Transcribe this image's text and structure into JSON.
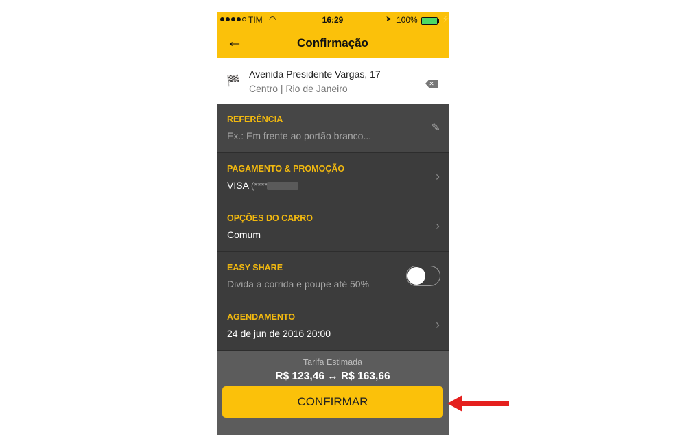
{
  "status_bar": {
    "carrier": "TIM",
    "time": "16:29",
    "battery": "100%"
  },
  "nav": {
    "title": "Confirmação"
  },
  "address": {
    "line1": "Avenida Presidente Vargas, 17",
    "line2": "Centro | Rio de Janeiro"
  },
  "rows": [
    {
      "label": "REFERÊNCIA",
      "placeholder": "Ex.: Em frente ao portão branco..."
    },
    {
      "label": "PAGAMENTO & PROMOÇÃO",
      "value": "VISA",
      "masked": "(****"
    },
    {
      "label": "OPÇÕES DO CARRO",
      "value": "Comum"
    },
    {
      "label": "EASY SHARE",
      "value": "Divida a corrida e poupe até 50%",
      "toggle_on": false
    },
    {
      "label": "AGENDAMENTO",
      "value": "24 de jun de 2016 20:00"
    }
  ],
  "fare": {
    "label": "Tarifa Estimada",
    "range": "R$ 123,46 ↔ R$ 163,66"
  },
  "confirm_label": "CONFIRMAR",
  "colors": {
    "brand_yellow": "#fbc10a",
    "label_yellow": "#f2b90f",
    "panel": "#3c3c3c",
    "arrow_red": "#e5201e"
  }
}
